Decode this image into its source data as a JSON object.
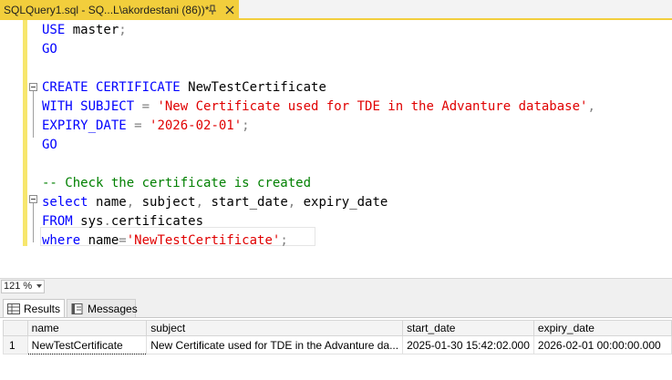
{
  "tab": {
    "title": "SQLQuery1.sql - SQ...L\\akordestani (86))*",
    "pin_glyph": "⊕",
    "close_glyph": "×"
  },
  "editor": {
    "lines": [
      [
        {
          "t": "USE ",
          "c": "kw"
        },
        {
          "t": "master",
          "c": "plain"
        },
        {
          "t": ";",
          "c": "gray"
        }
      ],
      [
        {
          "t": "GO",
          "c": "kw"
        }
      ],
      [],
      [
        {
          "t": "CREATE CERTIFICATE ",
          "c": "kw"
        },
        {
          "t": "NewTestCertificate",
          "c": "plain"
        }
      ],
      [
        {
          "t": "WITH SUBJECT ",
          "c": "kw"
        },
        {
          "t": "= ",
          "c": "gray"
        },
        {
          "t": "'New Certificate used for TDE in the Advanture database'",
          "c": "str"
        },
        {
          "t": ",",
          "c": "gray"
        }
      ],
      [
        {
          "t": "EXPIRY_DATE ",
          "c": "kw"
        },
        {
          "t": "= ",
          "c": "gray"
        },
        {
          "t": "'2026-02-01'",
          "c": "str"
        },
        {
          "t": ";",
          "c": "gray"
        }
      ],
      [
        {
          "t": "GO",
          "c": "kw"
        }
      ],
      [],
      [
        {
          "t": "-- Check the certificate is created",
          "c": "cmt"
        }
      ],
      [
        {
          "t": "select ",
          "c": "kw"
        },
        {
          "t": "name",
          "c": "plain"
        },
        {
          "t": ", ",
          "c": "gray"
        },
        {
          "t": "subject",
          "c": "plain"
        },
        {
          "t": ", ",
          "c": "gray"
        },
        {
          "t": "start_date",
          "c": "plain"
        },
        {
          "t": ", ",
          "c": "gray"
        },
        {
          "t": "expiry_date",
          "c": "plain"
        }
      ],
      [
        {
          "t": "FROM ",
          "c": "kw"
        },
        {
          "t": "sys",
          "c": "plain"
        },
        {
          "t": ".",
          "c": "gray"
        },
        {
          "t": "certificates",
          "c": "plain"
        }
      ],
      [
        {
          "t": "where ",
          "c": "kw"
        },
        {
          "t": "name",
          "c": "plain"
        },
        {
          "t": "=",
          "c": "gray"
        },
        {
          "t": "'NewTestCertificate'",
          "c": "str"
        },
        {
          "t": ";",
          "c": "gray"
        }
      ]
    ]
  },
  "zoom": {
    "value": "121 %"
  },
  "results": {
    "tabs": [
      {
        "label": "Results",
        "icon": "grid-icon",
        "active": true
      },
      {
        "label": "Messages",
        "icon": "messages-icon",
        "active": false
      }
    ],
    "columns": [
      "name",
      "subject",
      "start_date",
      "expiry_date"
    ],
    "rows": [
      {
        "num": "1",
        "cells": [
          "NewTestCertificate",
          "New Certificate used for TDE in the Advanture da...",
          "2025-01-30 15:42:02.000",
          "2026-02-01 00:00:00.000"
        ]
      }
    ]
  },
  "colors": {
    "tab_accent": "#f2ce3c",
    "keyword": "#0000ff",
    "string": "#e00000",
    "comment": "#008000",
    "change_margin": "#f7e66d"
  }
}
